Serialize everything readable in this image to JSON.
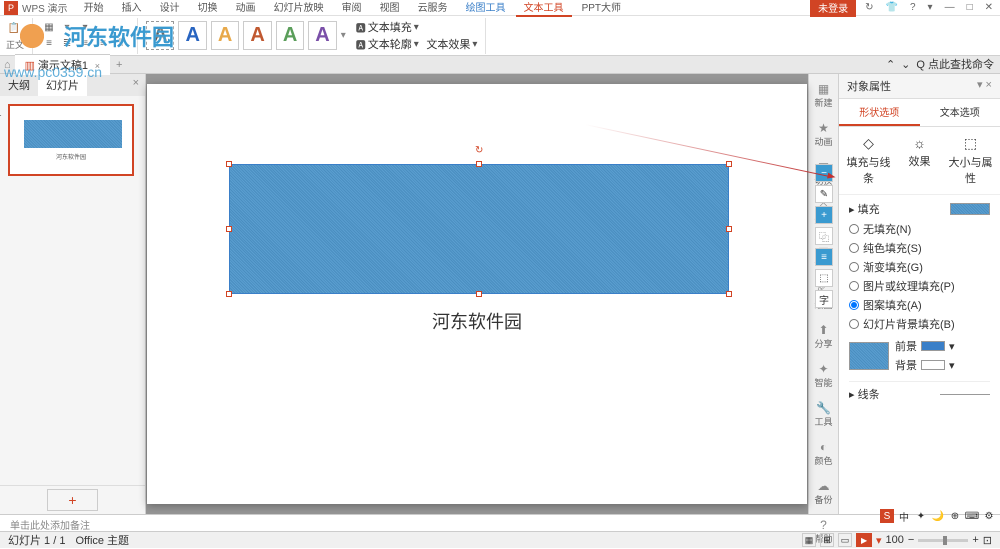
{
  "app": {
    "name": "WPS 演示",
    "login": "未登录"
  },
  "menu": [
    "开始",
    "插入",
    "设计",
    "切换",
    "动画",
    "幻灯片放映",
    "审阅",
    "视图",
    "云服务",
    "绘图工具",
    "文本工具",
    "PPT大师"
  ],
  "toolbar": {
    "textFill": "文本填充",
    "textOutline": "文本轮廓",
    "textEffect": "文本效果"
  },
  "tabs": {
    "doc": "演示文稿1"
  },
  "leftPanel": {
    "tab1": "大纲",
    "tab2": "幻灯片",
    "thumbText": "河东软件园"
  },
  "canvas": {
    "text": "河东软件园"
  },
  "strip": [
    "新建",
    "动画",
    "切换",
    "形状",
    "属性",
    "绘图",
    "分享",
    "智能",
    "工具",
    "颜色",
    "备份",
    "帮助"
  ],
  "prop": {
    "title": "对象属性",
    "tab1": "形状选项",
    "tab2": "文本选项",
    "sub1": "填充与线条",
    "sub2": "效果",
    "sub3": "大小与属性",
    "fillHead": "填充",
    "radios": [
      "无填充(N)",
      "纯色填充(S)",
      "渐变填充(G)",
      "图片或纹理填充(P)",
      "图案填充(A)",
      "幻灯片背景填充(B)"
    ],
    "fg": "前景",
    "bg": "背景",
    "lineHead": "线条"
  },
  "search": {
    "placeholder": "Q 点此查找命令"
  },
  "notes": "单击此处添加备注",
  "status": {
    "slide": "幻灯片 1 / 1",
    "theme": "Office 主题",
    "zoom": "100"
  }
}
